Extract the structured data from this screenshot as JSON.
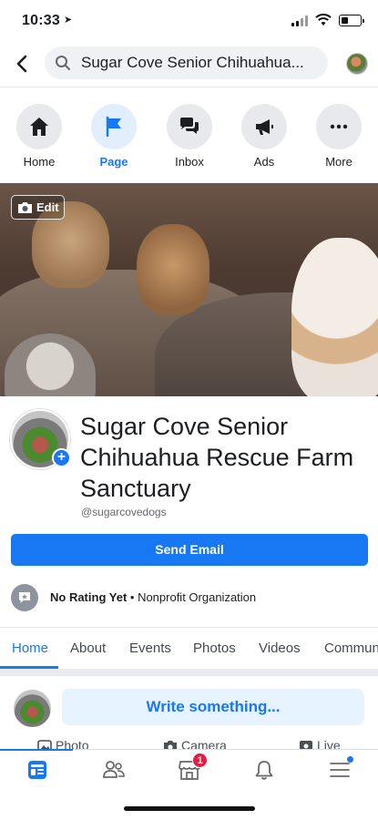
{
  "status": {
    "time": "10:33",
    "location_arrow": "➤"
  },
  "search": {
    "query": "Sugar Cove Senior Chihuahua..."
  },
  "actions": [
    {
      "label": "Home",
      "icon": "home-icon"
    },
    {
      "label": "Page",
      "icon": "flag-icon"
    },
    {
      "label": "Inbox",
      "icon": "chat-bubbles-icon"
    },
    {
      "label": "Ads",
      "icon": "megaphone-icon"
    },
    {
      "label": "More",
      "icon": "more-dots-icon"
    }
  ],
  "cover": {
    "edit_label": "Edit"
  },
  "profile": {
    "name": "Sugar Cove Senior Chihuahua Rescue Farm Sanctuary",
    "handle": "@sugarcovedogs",
    "add_symbol": "+"
  },
  "send_button": "Send Email",
  "rating": {
    "status": "No Rating Yet",
    "separator": " • ",
    "category": "Nonprofit Organization"
  },
  "tabs": [
    "Home",
    "About",
    "Events",
    "Photos",
    "Videos",
    "Commun"
  ],
  "composer": {
    "prompt": "Write something...",
    "options": [
      "Photo",
      "Camera",
      "Live"
    ]
  },
  "bottom_nav": {
    "items": [
      "feed-icon",
      "friends-icon",
      "marketplace-icon",
      "bell-icon",
      "menu-icon"
    ],
    "marketplace_badge": "1"
  },
  "colors": {
    "accent": "#1877f2",
    "badge": "#e41e3f"
  }
}
